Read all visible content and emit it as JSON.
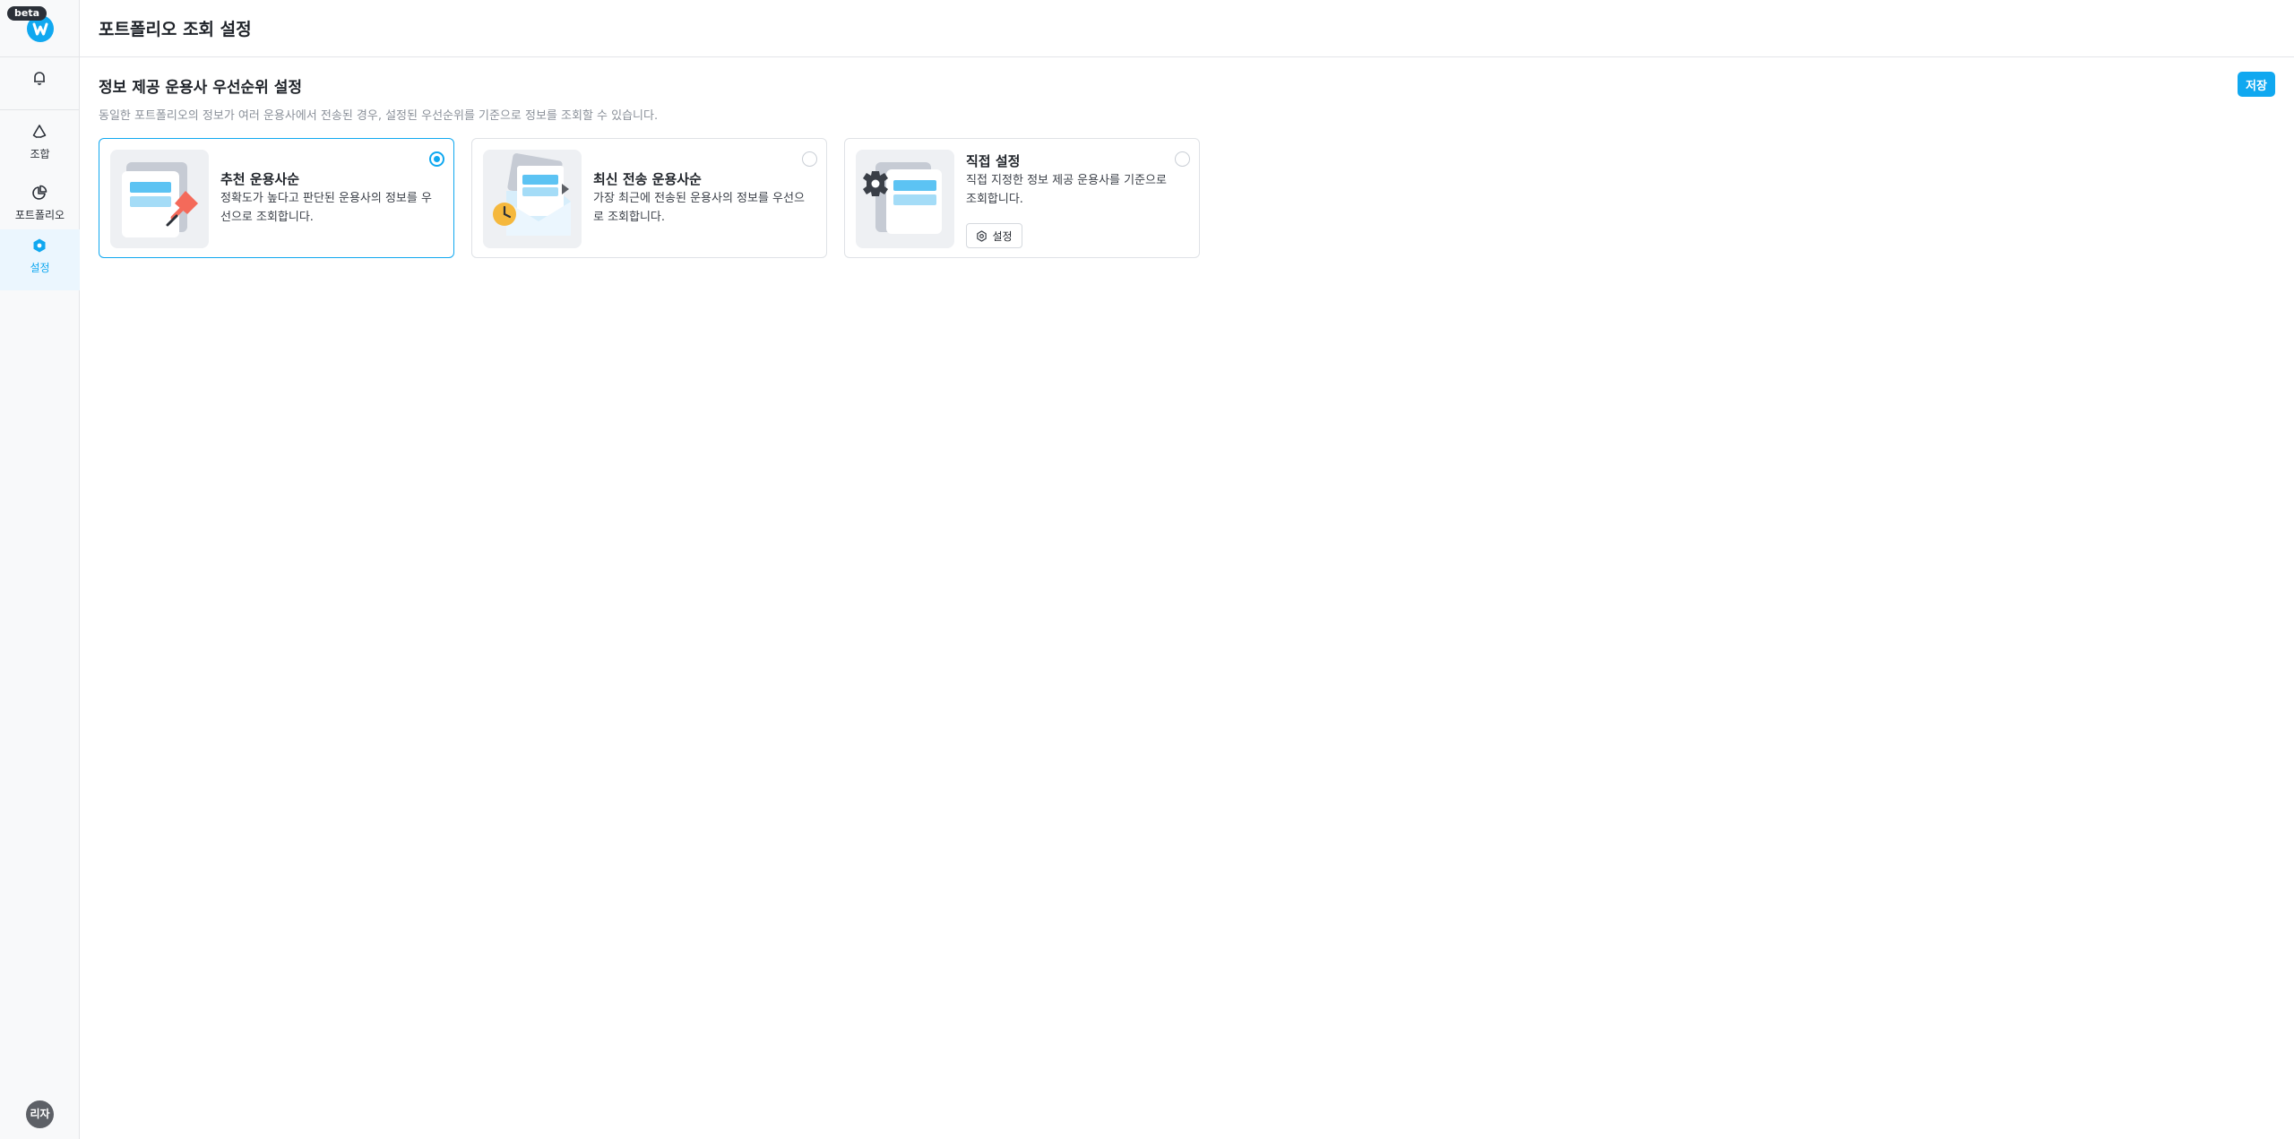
{
  "app": {
    "badge": "beta"
  },
  "sidebar": {
    "items": [
      {
        "label": "조합",
        "icon": "recycle-icon"
      },
      {
        "label": "포트폴리오",
        "icon": "pie-chart-icon"
      },
      {
        "label": "설정",
        "icon": "settings-icon",
        "active": true
      }
    ],
    "user_initials": "리자"
  },
  "header": {
    "title": "포트폴리오 조회 설정"
  },
  "section": {
    "title": "정보 제공 운용사 우선순위 설정",
    "description": "동일한 포트폴리오의 정보가 여러 운용사에서 전송된 경우, 설정된 우선순위를 기준으로 정보를 조회할 수 있습니다.",
    "save_label": "저장"
  },
  "options": [
    {
      "title": "추천 운용사순",
      "description": "정확도가 높다고 판단된 운용사의 정보를 우선으로 조회합니다.",
      "selected": true
    },
    {
      "title": "최신 전송 운용사순",
      "description": "가장 최근에 전송된 운용사의 정보를 우선으로 조회합니다.",
      "selected": false
    },
    {
      "title": "직접 설정",
      "description": "직접 지정한 정보 제공 운용사를 기준으로 조회합니다.",
      "selected": false,
      "button_label": "설정"
    }
  ],
  "colors": {
    "accent": "#10a8f0",
    "pin": "#f46a5a",
    "clock": "#f5b83d"
  }
}
